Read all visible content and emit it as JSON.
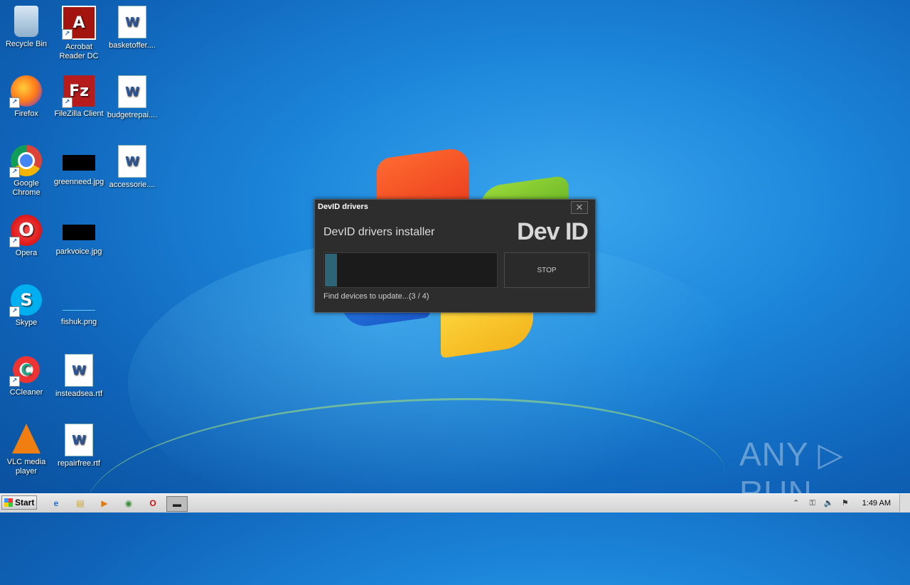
{
  "desktop": {
    "icons": [
      {
        "label": "Recycle Bin",
        "icon": "recycle-bin-icon",
        "glyph": ""
      },
      {
        "label": "Acrobat Reader DC",
        "icon": "acrobat-icon",
        "glyph": "A"
      },
      {
        "label": "basketoffer....",
        "icon": "word-doc-icon",
        "glyph": "W"
      },
      {
        "label": "Firefox",
        "icon": "firefox-icon",
        "glyph": ""
      },
      {
        "label": "FileZilla Client",
        "icon": "filezilla-icon",
        "glyph": "Fz"
      },
      {
        "label": "budgetrepai....",
        "icon": "word-doc-icon",
        "glyph": "W"
      },
      {
        "label": "Google Chrome",
        "icon": "chrome-icon",
        "glyph": ""
      },
      {
        "label": "greenneed.jpg",
        "icon": "image-file-icon",
        "glyph": ""
      },
      {
        "label": "accessorie....",
        "icon": "word-doc-icon",
        "glyph": "W"
      },
      {
        "label": "Opera",
        "icon": "opera-icon",
        "glyph": "O"
      },
      {
        "label": "parkvoice.jpg",
        "icon": "image-file-icon",
        "glyph": ""
      },
      {
        "label": "Skype",
        "icon": "skype-icon",
        "glyph": "S"
      },
      {
        "label": "fishuk.png",
        "icon": "image-file-icon",
        "glyph": ""
      },
      {
        "label": "CCleaner",
        "icon": "ccleaner-icon",
        "glyph": "C"
      },
      {
        "label": "insteadsea.rtf",
        "icon": "word-doc-icon",
        "glyph": "W"
      },
      {
        "label": "VLC media player",
        "icon": "vlc-icon",
        "glyph": ""
      },
      {
        "label": "repairfree.rtf",
        "icon": "word-doc-icon",
        "glyph": "W"
      }
    ]
  },
  "dialog": {
    "title": "DevID drivers",
    "close_glyph": "✕",
    "heading": "DevID drivers installer",
    "logo": "Dev ID",
    "progress": 0.07,
    "stop_label": "STOP",
    "status": "Find devices to update...(3 / 4)"
  },
  "watermark": "ANY ▷ RUN",
  "taskbar": {
    "start_label": "Start",
    "apps": [
      {
        "icon": "internet-explorer-icon",
        "glyph": "e"
      },
      {
        "icon": "file-explorer-icon",
        "glyph": "▤"
      },
      {
        "icon": "media-player-icon",
        "glyph": "▶"
      },
      {
        "icon": "chrome-icon",
        "glyph": "◉"
      },
      {
        "icon": "opera-icon",
        "glyph": "O"
      },
      {
        "icon": "devid-app-icon",
        "glyph": "▬"
      }
    ],
    "tray": {
      "glyphs": [
        "⌃",
        "⚿",
        "🔈",
        "⚑"
      ],
      "clock": "1:49 AM"
    }
  }
}
